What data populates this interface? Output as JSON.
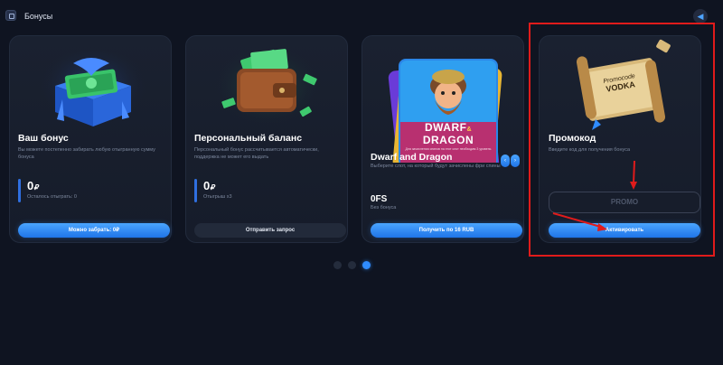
{
  "header": {
    "title": "Бонусы",
    "menu_icon": "bonus-box-icon",
    "back_icon": "back-arrow-icon"
  },
  "cards": [
    {
      "title": "Ваш бонус",
      "description": "Вы можете постепенно забирать любую отыгранную сумму бонуса",
      "amount": "0",
      "currency": "₽",
      "amount_sub": "Осталось отыграть: 0",
      "button": "Можно забрать: 0₽",
      "image": "gift-box-icon"
    },
    {
      "title": "Персональный баланс",
      "description": "Персональный бонус рассчитывается автоматически, поддержка не может его выдать",
      "amount": "0",
      "currency": "₽",
      "amount_sub": "Отыгрыш x3",
      "button": "Отправить запрос",
      "image": "wallet-icon"
    },
    {
      "title": "Dwarf and Dragon",
      "description": "Выберите слот, на который будут зачислены фри спины",
      "amount": "0FS",
      "amount_sub": "Без бонуса",
      "button": "Получить по 16 RUB",
      "image": "slot-game-icon",
      "game_card": {
        "line1": "DWARF",
        "amp": "&",
        "line2": "DRAGON",
        "caption": "Для зачисления спинов на этот слот необходим 3 уровень"
      },
      "nav_prev": "‹",
      "nav_next": "›"
    },
    {
      "title": "Промокод",
      "description": "Введите код для получения бонуса",
      "input_placeholder": "PROMO",
      "button": "Активировать",
      "image": "scroll-icon",
      "scroll_text_1": "Promocode",
      "scroll_text_2": "VODKA"
    }
  ],
  "pagination": {
    "total": 3,
    "active": 3
  },
  "colors": {
    "background": "#0f1421",
    "card": "#1a2130",
    "accent": "#2f8cff",
    "annotation": "#e01b1b"
  }
}
